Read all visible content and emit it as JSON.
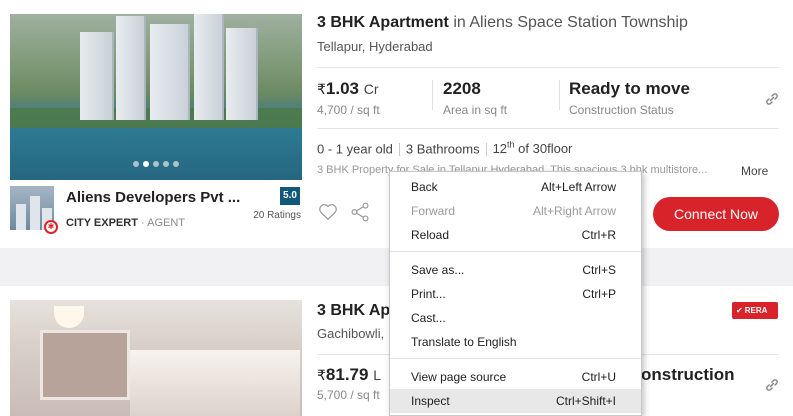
{
  "listing1": {
    "title_bold": "3 BHK Apartment",
    "title_rest": " in Aliens Space Station Township",
    "locality": "Tellapur, Hyderabad",
    "price_symbol": "₹",
    "price_value": "1.03",
    "price_unit": "Cr",
    "price_per_sqft": "4,700 / sq ft",
    "area_value": "2208",
    "area_label": "Area in sq ft",
    "status_value": "Ready to move",
    "status_label": "Construction Status",
    "age": "0 - 1 year old",
    "bathrooms": "3 Bathrooms",
    "floor_num": "12",
    "floor_sup": "th",
    "floor_rest": " of 30floor",
    "description": "3 BHK Property for Sale in Tellapur Hyderabad. This spacious 3 bhk multistore...",
    "more_label": "More",
    "agent_name": "Aliens Developers Pvt ...",
    "agent_tag": "CITY EXPERT",
    "agent_role": " · AGENT",
    "rating": "5.0",
    "rating_count": "20 Ratings",
    "connect_label": "Connect Now",
    "photo_slides": 5,
    "photo_active": 2
  },
  "listing2": {
    "title_bold": "3 BHK Ap",
    "locality": "Gachibowli,",
    "price_symbol": "₹",
    "price_value": "81.79",
    "price_unit": "L",
    "price_per_sqft": "5,700 / sq ft",
    "status_partial": "onstruction",
    "rera_label": "RERA"
  },
  "context_menu": {
    "items": [
      {
        "label": "Back",
        "shortcut": "Alt+Left Arrow",
        "disabled": false
      },
      {
        "label": "Forward",
        "shortcut": "Alt+Right Arrow",
        "disabled": true
      },
      {
        "label": "Reload",
        "shortcut": "Ctrl+R",
        "disabled": false
      },
      {
        "label": "Save as...",
        "shortcut": "Ctrl+S",
        "disabled": false
      },
      {
        "label": "Print...",
        "shortcut": "Ctrl+P",
        "disabled": false
      },
      {
        "label": "Cast...",
        "shortcut": "",
        "disabled": false
      },
      {
        "label": "Translate to English",
        "shortcut": "",
        "disabled": false
      },
      {
        "label": "View page source",
        "shortcut": "Ctrl+U",
        "disabled": false
      },
      {
        "label": "Inspect",
        "shortcut": "Ctrl+Shift+I",
        "disabled": false,
        "highlighted": true
      }
    ]
  },
  "colors": {
    "accent": "#d8232a",
    "rating_bg": "#13587a",
    "menu_hover": "#e8e8e8"
  }
}
